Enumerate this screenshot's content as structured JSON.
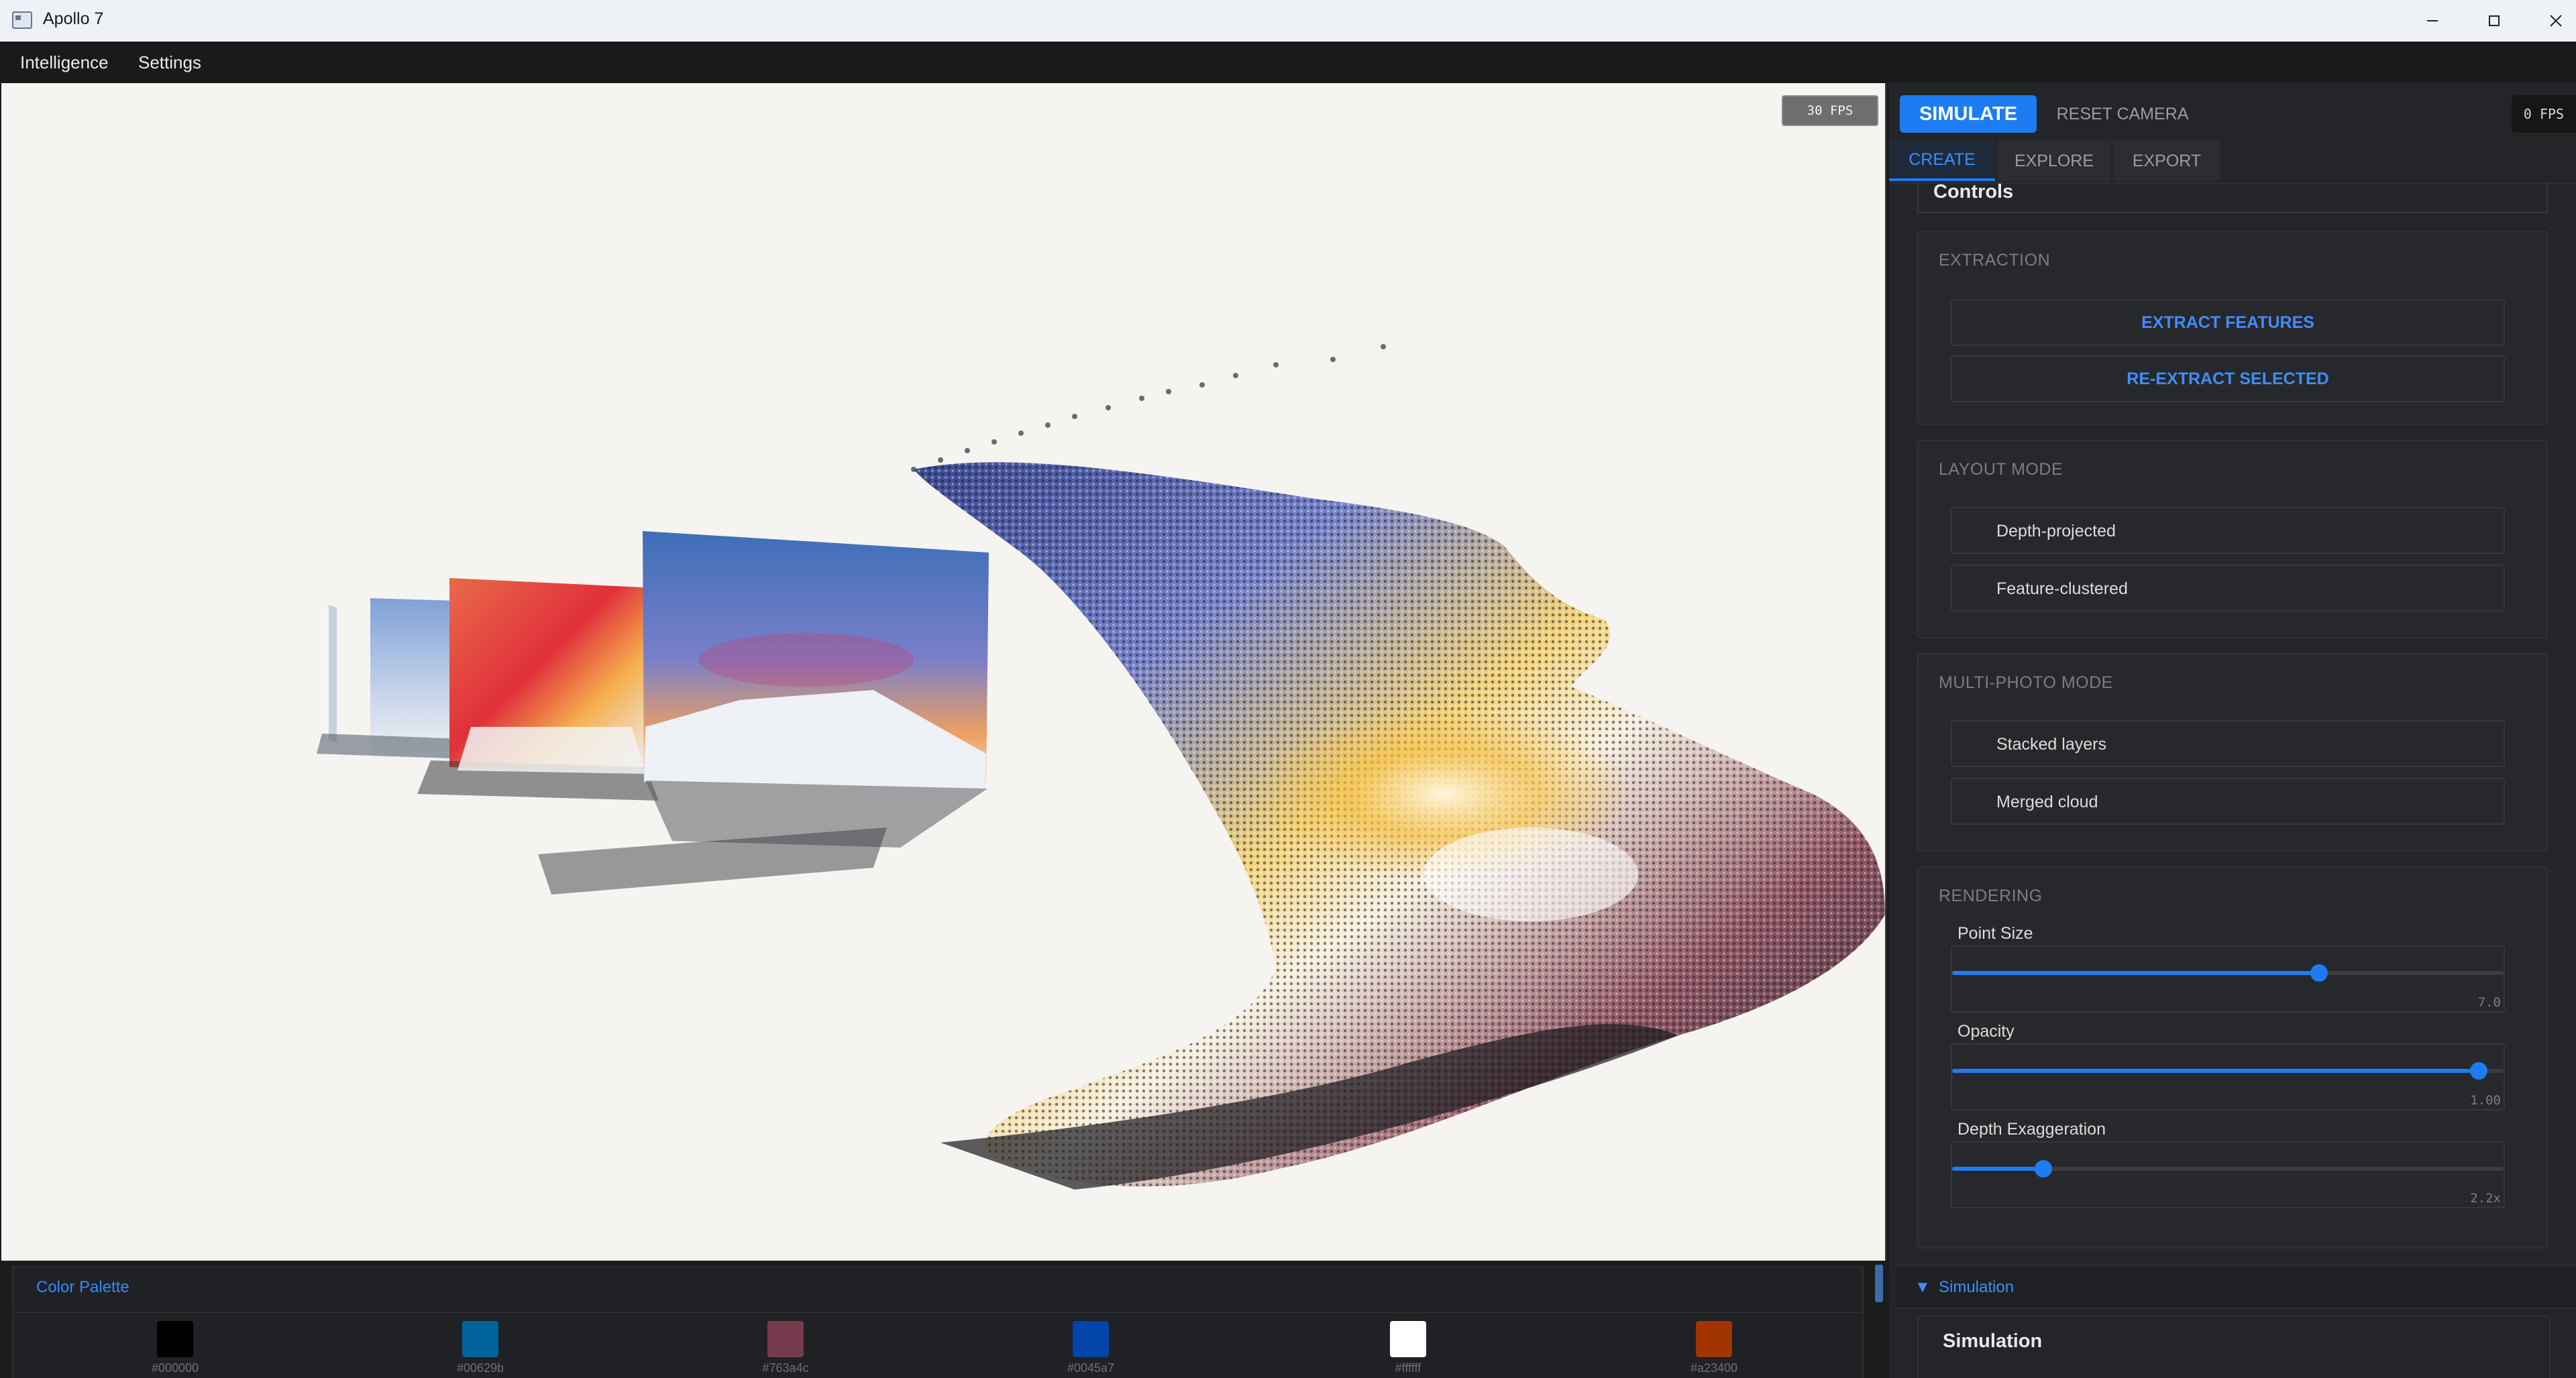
{
  "window": {
    "title": "Apollo 7"
  },
  "menu": {
    "items": [
      "Intelligence",
      "Settings"
    ]
  },
  "viewport": {
    "fps": "30 FPS"
  },
  "palette": {
    "title": "Color Palette",
    "swatches": [
      {
        "color": "#000000",
        "label": "#000000"
      },
      {
        "color": "#00629b",
        "label": "#00629b"
      },
      {
        "color": "#763a4c",
        "label": "#763a4c"
      },
      {
        "color": "#0045a7",
        "label": "#0045a7"
      },
      {
        "color": "#ffffff",
        "label": "#ffffff"
      },
      {
        "color": "#a23400",
        "label": "#a23400"
      }
    ]
  },
  "panel": {
    "simulate_label": "SIMULATE",
    "reset_label": "RESET CAMERA",
    "fps": "0 FPS",
    "tabs": [
      "CREATE",
      "EXPLORE",
      "EXPORT"
    ],
    "active_tab": "CREATE",
    "controls_title": "Controls",
    "extraction": {
      "label": "EXTRACTION",
      "extract_button": "EXTRACT FEATURES",
      "reextract_button": "RE-EXTRACT SELECTED"
    },
    "layout_mode": {
      "label": "LAYOUT MODE",
      "options": [
        "Depth-projected",
        "Feature-clustered"
      ]
    },
    "multi_photo_mode": {
      "label": "MULTI-PHOTO MODE",
      "options": [
        "Stacked layers",
        "Merged cloud"
      ]
    },
    "rendering": {
      "label": "RENDERING",
      "point_size": {
        "label": "Point Size",
        "value": "7.0",
        "fraction": 0.665
      },
      "opacity": {
        "label": "Opacity",
        "value": "1.00",
        "fraction": 0.955
      },
      "depth": {
        "label": "Depth Exaggeration",
        "value": "2.2x",
        "fraction": 0.165
      }
    },
    "simulation": {
      "header": "Simulation",
      "arrow": "▼",
      "title": "Simulation"
    }
  },
  "colors": {
    "accent": "#1d7cf2",
    "panel_bg": "#242528",
    "viewport_bg": "#f6f4f1"
  }
}
